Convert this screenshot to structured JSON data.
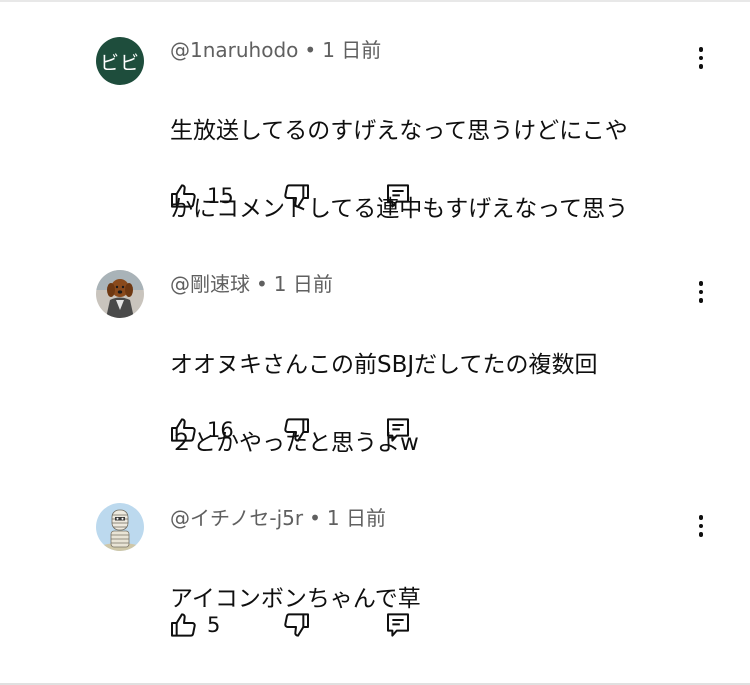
{
  "comments": [
    {
      "avatar": {
        "type": "initials",
        "text": "ビビ",
        "color": "#1e4d3c"
      },
      "author": "@1naruhodo",
      "separator": "•",
      "time": "1 日前",
      "text_lines": [
        "生放送してるのすげえなって思うけどにこや",
        "かにコメントしてる連中もすげえなって思う"
      ],
      "likes": "15"
    },
    {
      "avatar": {
        "type": "photo",
        "description_icon": "dog-avatar-icon"
      },
      "author": "@剛速球",
      "separator": "•",
      "time": "1 日前",
      "text_lines": [
        "オオヌキさんこの前SBJだしてたの複数回",
        "２とかやったと思うよw"
      ],
      "likes": "16"
    },
    {
      "avatar": {
        "type": "photo",
        "description_icon": "mummy-avatar-icon"
      },
      "author": "@イチノセ-j5r",
      "separator": "•",
      "time": "1 日前",
      "text_lines": [
        "アイコンボンちゃんで草"
      ],
      "likes": "5"
    }
  ],
  "icons": {
    "like": "thumbs-up-icon",
    "dislike": "thumbs-down-icon",
    "reply": "reply-icon",
    "more": "more-vert-icon"
  },
  "colors": {
    "text": "#0f0f0f",
    "meta": "#606060",
    "avatar_green": "#1e4d3c"
  }
}
